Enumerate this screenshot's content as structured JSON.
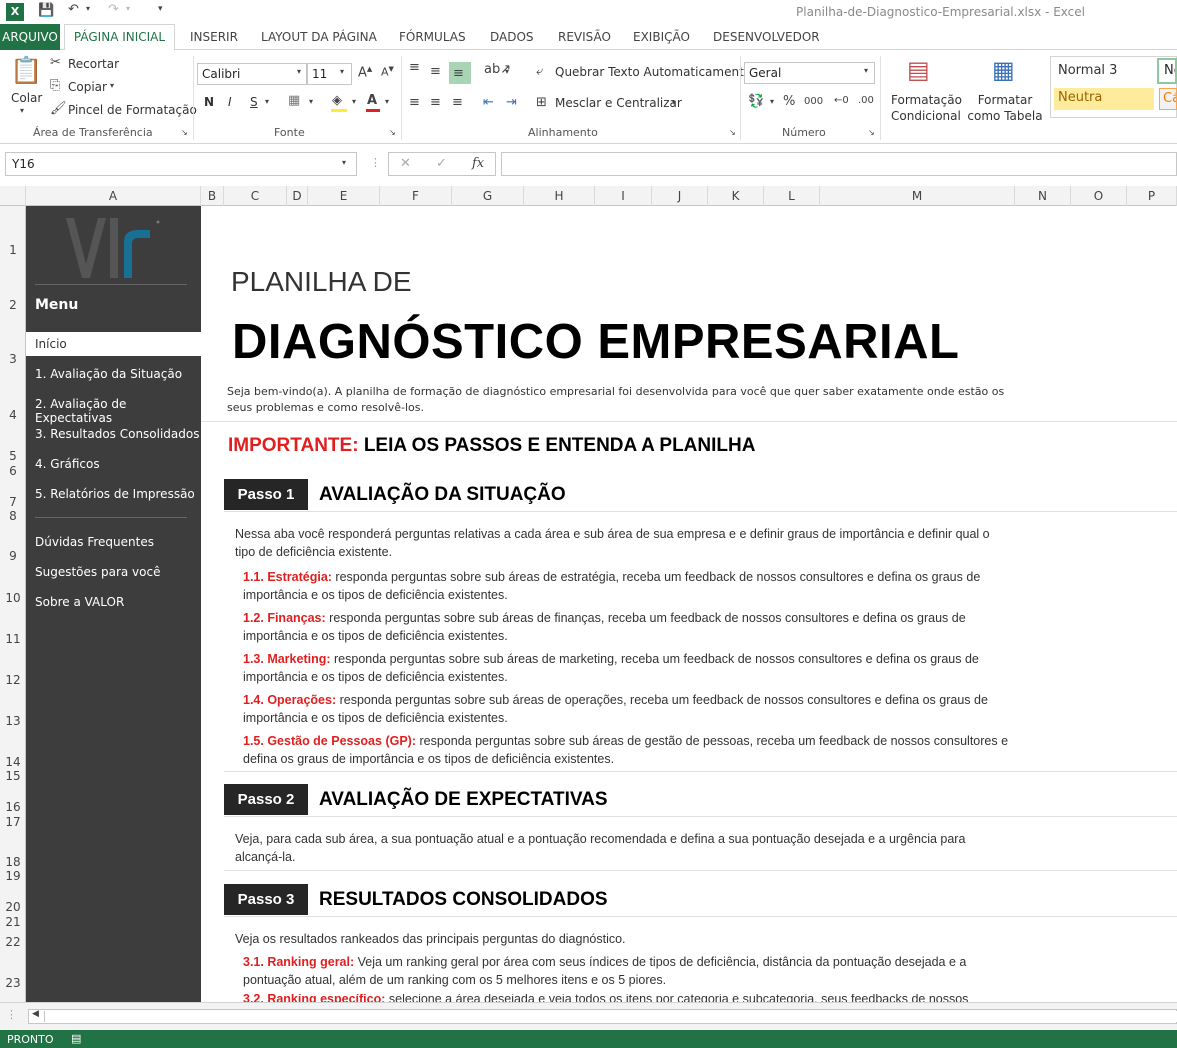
{
  "window": {
    "title": "Planilha-de-Diagnostico-Empresarial.xlsx - Excel"
  },
  "tabs": {
    "file": "ARQUIVO",
    "home": "PÁGINA INICIAL",
    "items": [
      "INSERIR",
      "LAYOUT DA PÁGINA",
      "FÓRMULAS",
      "DADOS",
      "REVISÃO",
      "EXIBIÇÃO",
      "DESENVOLVEDOR"
    ]
  },
  "ribbon": {
    "clipboard": {
      "paste": "Colar",
      "cut": "Recortar",
      "copy": "Copiar",
      "format_painter": "Pincel de Formatação",
      "label": "Área de Transferência"
    },
    "font": {
      "name": "Calibri",
      "size": "11",
      "bold": "N",
      "italic": "I",
      "underline": "S",
      "label": "Fonte"
    },
    "alignment": {
      "wrap": "Quebrar Texto Automaticamente",
      "merge": "Mesclar e Centralizar",
      "label": "Alinhamento"
    },
    "number": {
      "format": "Geral",
      "label": "Número"
    },
    "styles": {
      "conditional": "Formatação Condicional",
      "table": "Formatar como Tabela",
      "normal3": "Normal 3",
      "neutral": "Neutra",
      "cut_left": "No",
      "cut_right": "Cá"
    }
  },
  "formula_bar": {
    "name_box": "Y16",
    "fx": "fx"
  },
  "columns": [
    "A",
    "B",
    "C",
    "D",
    "E",
    "F",
    "G",
    "H",
    "I",
    "J",
    "K",
    "L",
    "M",
    "N",
    "O",
    "P"
  ],
  "rows": [
    "1",
    "2",
    "3",
    "4",
    "5",
    "6",
    "7",
    "8",
    "9",
    "10",
    "11",
    "12",
    "13",
    "14",
    "15",
    "16",
    "17",
    "18",
    "19",
    "20",
    "21",
    "22",
    "23"
  ],
  "sidebar": {
    "menu_title": "Menu",
    "items": [
      "Início",
      "1. Avaliação da Situação",
      "2. Avaliação de Expectativas",
      "3. Resultados Consolidados",
      "4. Gráficos",
      "5. Relatórios de Impressão"
    ],
    "extra": [
      "Dúvidas Frequentes",
      "Sugestões para você",
      "Sobre a VALOR"
    ]
  },
  "content": {
    "pre_title": "PLANILHA DE",
    "title": "DIAGNÓSTICO EMPRESARIAL",
    "intro": "Seja bem-vindo(a). A planilha de formação de diagnóstico empresarial foi desenvolvida para você que quer saber exatamente onde estão os seus problemas e como resolvê-los.",
    "important_label": "IMPORTANTE:",
    "important_text": "LEIA OS PASSOS E ENTENDA A PLANILHA",
    "steps": [
      {
        "badge": "Passo 1",
        "title": "AVALIAÇÃO DA SITUAÇÃO",
        "desc": "Nessa aba você responderá perguntas relativas a cada área e sub área de sua empresa e e definir graus de importância e definir qual o tipo de deficiência existente.",
        "items": [
          {
            "label": "1.1. Estratégia:",
            "text": " responda perguntas sobre sub áreas de estratégia, receba um feedback de nossos consultores e defina os graus de importância e os tipos de deficiência existentes."
          },
          {
            "label": "1.2. Finanças:",
            "text": " responda perguntas sobre sub áreas de finanças, receba um feedback de nossos consultores e defina os graus de importância e os tipos de deficiência existentes."
          },
          {
            "label": "1.3. Marketing:",
            "text": " responda perguntas sobre sub áreas de marketing, receba um feedback de nossos consultores e defina os graus de importância e os tipos de deficiência existentes."
          },
          {
            "label": "1.4. Operações:",
            "text": " responda perguntas sobre sub áreas de operações, receba um feedback de nossos consultores e defina os graus de importância e os tipos de deficiência existentes."
          },
          {
            "label": "1.5. Gestão de Pessoas (GP):",
            "text": " responda perguntas sobre sub áreas de gestão de pessoas, receba um feedback de nossos consultores e defina os graus de importância e os tipos de deficiência existentes."
          }
        ]
      },
      {
        "badge": "Passo 2",
        "title": "AVALIAÇÃO DE EXPECTATIVAS",
        "desc": "Veja, para cada sub área, a sua pontuação atual e a pontuação recomendada e defina a sua pontuação desejada e a urgência para alcançá-la."
      },
      {
        "badge": "Passo 3",
        "title": "RESULTADOS CONSOLIDADOS",
        "desc": "Veja os resultados rankeados das principais perguntas do diagnóstico.",
        "items": [
          {
            "label": "3.1. Ranking geral:",
            "text": " Veja um ranking geral por área com seus índices de tipos de deficiência, distância da pontuação desejada e a pontuação atual, além de um ranking com os 5 melhores itens e os 5 piores."
          },
          {
            "label": "3.2. Ranking específico:",
            "text": " selecione a área desejada e veja todos os itens por categoria e subcategoria, seus feedbacks de nossos"
          }
        ]
      }
    ]
  },
  "status": {
    "ready": "PRONTO"
  },
  "colors": {
    "excel_green": "#217346",
    "sidebar": "#3d3d3d",
    "accent_red": "#e02020"
  }
}
